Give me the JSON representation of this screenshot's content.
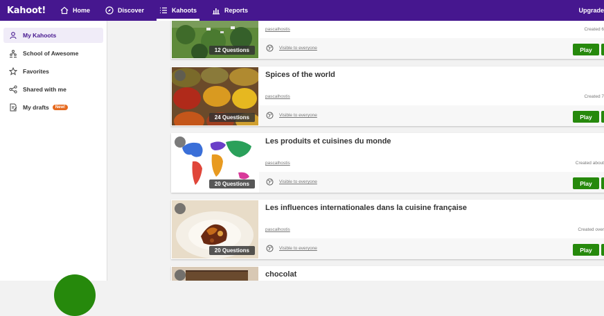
{
  "topbar": {
    "logo": "Kahoot!",
    "nav": [
      {
        "label": "Home",
        "icon": "home-icon"
      },
      {
        "label": "Discover",
        "icon": "compass-icon"
      },
      {
        "label": "Kahoots",
        "icon": "list-icon"
      },
      {
        "label": "Reports",
        "icon": "bar-chart-icon"
      }
    ],
    "upgrade": "Upgrade"
  },
  "sidebar": {
    "items": [
      {
        "label": "My Kahoots",
        "icon": "user-icon"
      },
      {
        "label": "School of Awesome",
        "icon": "team-icon"
      },
      {
        "label": "Favorites",
        "icon": "star-icon"
      },
      {
        "label": "Shared with me",
        "icon": "share-icon"
      },
      {
        "label": "My drafts",
        "icon": "drafts-icon",
        "badge": "New!"
      }
    ]
  },
  "cards": [
    {
      "title": "",
      "questions": "12 Questions",
      "author": "pascalhostis",
      "created": "Created 6",
      "visibility": "Visible to everyone",
      "play": "Play"
    },
    {
      "title": "Spices of the world",
      "questions": "24 Questions",
      "author": "pascalhostis",
      "created": "Created 7",
      "visibility": "Visible to everyone",
      "play": "Play"
    },
    {
      "title": "Les produits et cuisines du monde",
      "questions": "20 Questions",
      "author": "pascalhostis",
      "created": "Created about",
      "visibility": "Visible to everyone",
      "play": "Play"
    },
    {
      "title": "Les influences internationales dans la cuisine française",
      "questions": "20 Questions",
      "author": "pascalhostis",
      "created": "Created over",
      "visibility": "Visible to everyone",
      "play": "Play"
    },
    {
      "title": "chocolat"
    }
  ],
  "colors": {
    "brand": "#46178f",
    "play": "#26890c",
    "badge": "#e66a1f"
  }
}
